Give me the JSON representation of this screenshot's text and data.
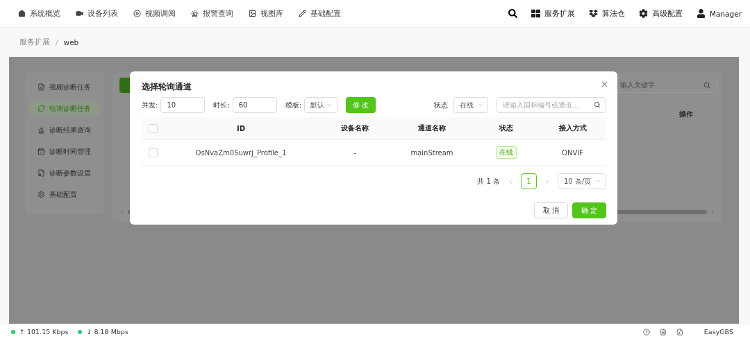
{
  "nav": {
    "items": [
      {
        "label": "系统概览"
      },
      {
        "label": "设备列表"
      },
      {
        "label": "视频调阅"
      },
      {
        "label": "报警查询"
      },
      {
        "label": "视图库"
      },
      {
        "label": "基础配置"
      }
    ],
    "right": [
      {
        "label": "服务扩展"
      },
      {
        "label": "算法仓"
      },
      {
        "label": "高级配置"
      }
    ],
    "user": "Manager"
  },
  "breadcrumb": {
    "items": [
      "服务扩展",
      "web"
    ],
    "separator": "/"
  },
  "sidebar": {
    "items": [
      {
        "label": "视频诊断任务",
        "selected": false
      },
      {
        "label": "轮询诊断任务",
        "selected": true
      },
      {
        "label": "诊断结果查询",
        "selected": false
      },
      {
        "label": "诊断时间管理",
        "selected": false
      },
      {
        "label": "诊断参数设置",
        "selected": false
      },
      {
        "label": "基础配置",
        "selected": false
      }
    ]
  },
  "content": {
    "search_placeholder": "输入关键字",
    "column": "操作"
  },
  "modal": {
    "title": "选择轮询通道",
    "fields": [
      {
        "label": "并发:",
        "value": "10",
        "kind": "input"
      },
      {
        "label": "时长:",
        "value": "60",
        "kind": "input"
      },
      {
        "label": "模板:",
        "value": "默认",
        "kind": "select"
      }
    ],
    "modify_button": "修 改",
    "status_filter": {
      "label": "状态",
      "value": "在线"
    },
    "search_placeholder": "请输入国标编号或通道...",
    "select_all_checked": false,
    "columns": [
      "ID",
      "设备名称",
      "通道名称",
      "状态",
      "接入方式"
    ],
    "rows": [
      {
        "checked": false,
        "id": "OsNvaZm05uwrj_Profile_1",
        "device_name": "-",
        "channel_name": "mainStream",
        "status": "在线",
        "access": "ONVIF"
      }
    ],
    "pagination": {
      "total": "共 1 条",
      "pages": [
        {
          "label": "1",
          "selected": true
        }
      ],
      "page_size": "10 条/页"
    },
    "cancel_button": "取 消",
    "ok_button": "确 定"
  },
  "status_bar": {
    "upload": "↑ 101.15 Kbps",
    "download": "↓ 8.18 Mbps",
    "app": "EasyGBS"
  }
}
